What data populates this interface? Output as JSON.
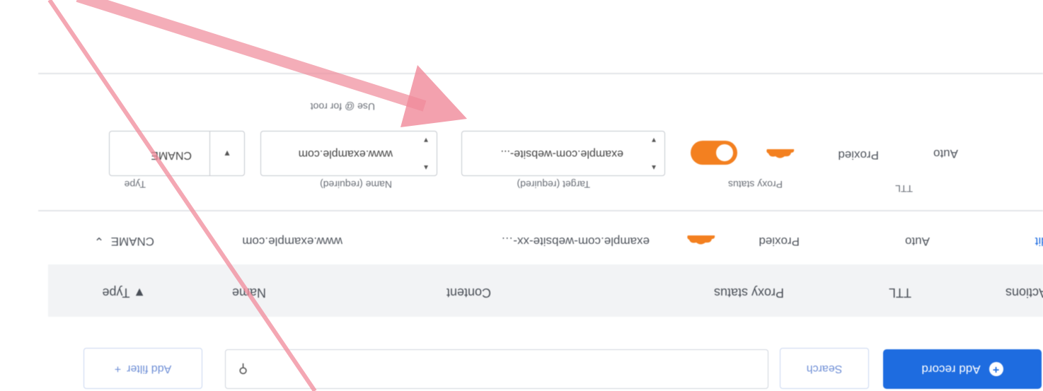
{
  "toolbar": {
    "add_record_label": "Add record",
    "search_button_label": "Search",
    "search_input_value": "",
    "search_icon_glyph": "⚲",
    "add_more_label": "Add filter",
    "add_more_icon": "+"
  },
  "table": {
    "columns": [
      "Type",
      "Name",
      "Content",
      "Proxy status",
      "TTL",
      "Actions"
    ],
    "sort_indicator": "▼",
    "row": {
      "type": "CNAME",
      "name": "www.example.com",
      "content": "example.com-website-xx-…",
      "proxy_status": "Proxied",
      "ttl": "Auto",
      "action": "Edit"
    }
  },
  "form": {
    "type_label": "Type",
    "type_value": "CNAME",
    "name_label": "Name (required)",
    "name_hint": "Use @ for root",
    "name_value": "www.example.com",
    "target_label": "Target (required)",
    "target_value": "example.com-website-...",
    "proxy_label": "Proxy status",
    "proxy_value": "Proxied",
    "ttl_label": "TTL",
    "ttl_value": "Auto"
  },
  "colors": {
    "accent": "#1e6ce0",
    "proxy_orange": "#f38020",
    "annotation": "#f08a9a"
  }
}
